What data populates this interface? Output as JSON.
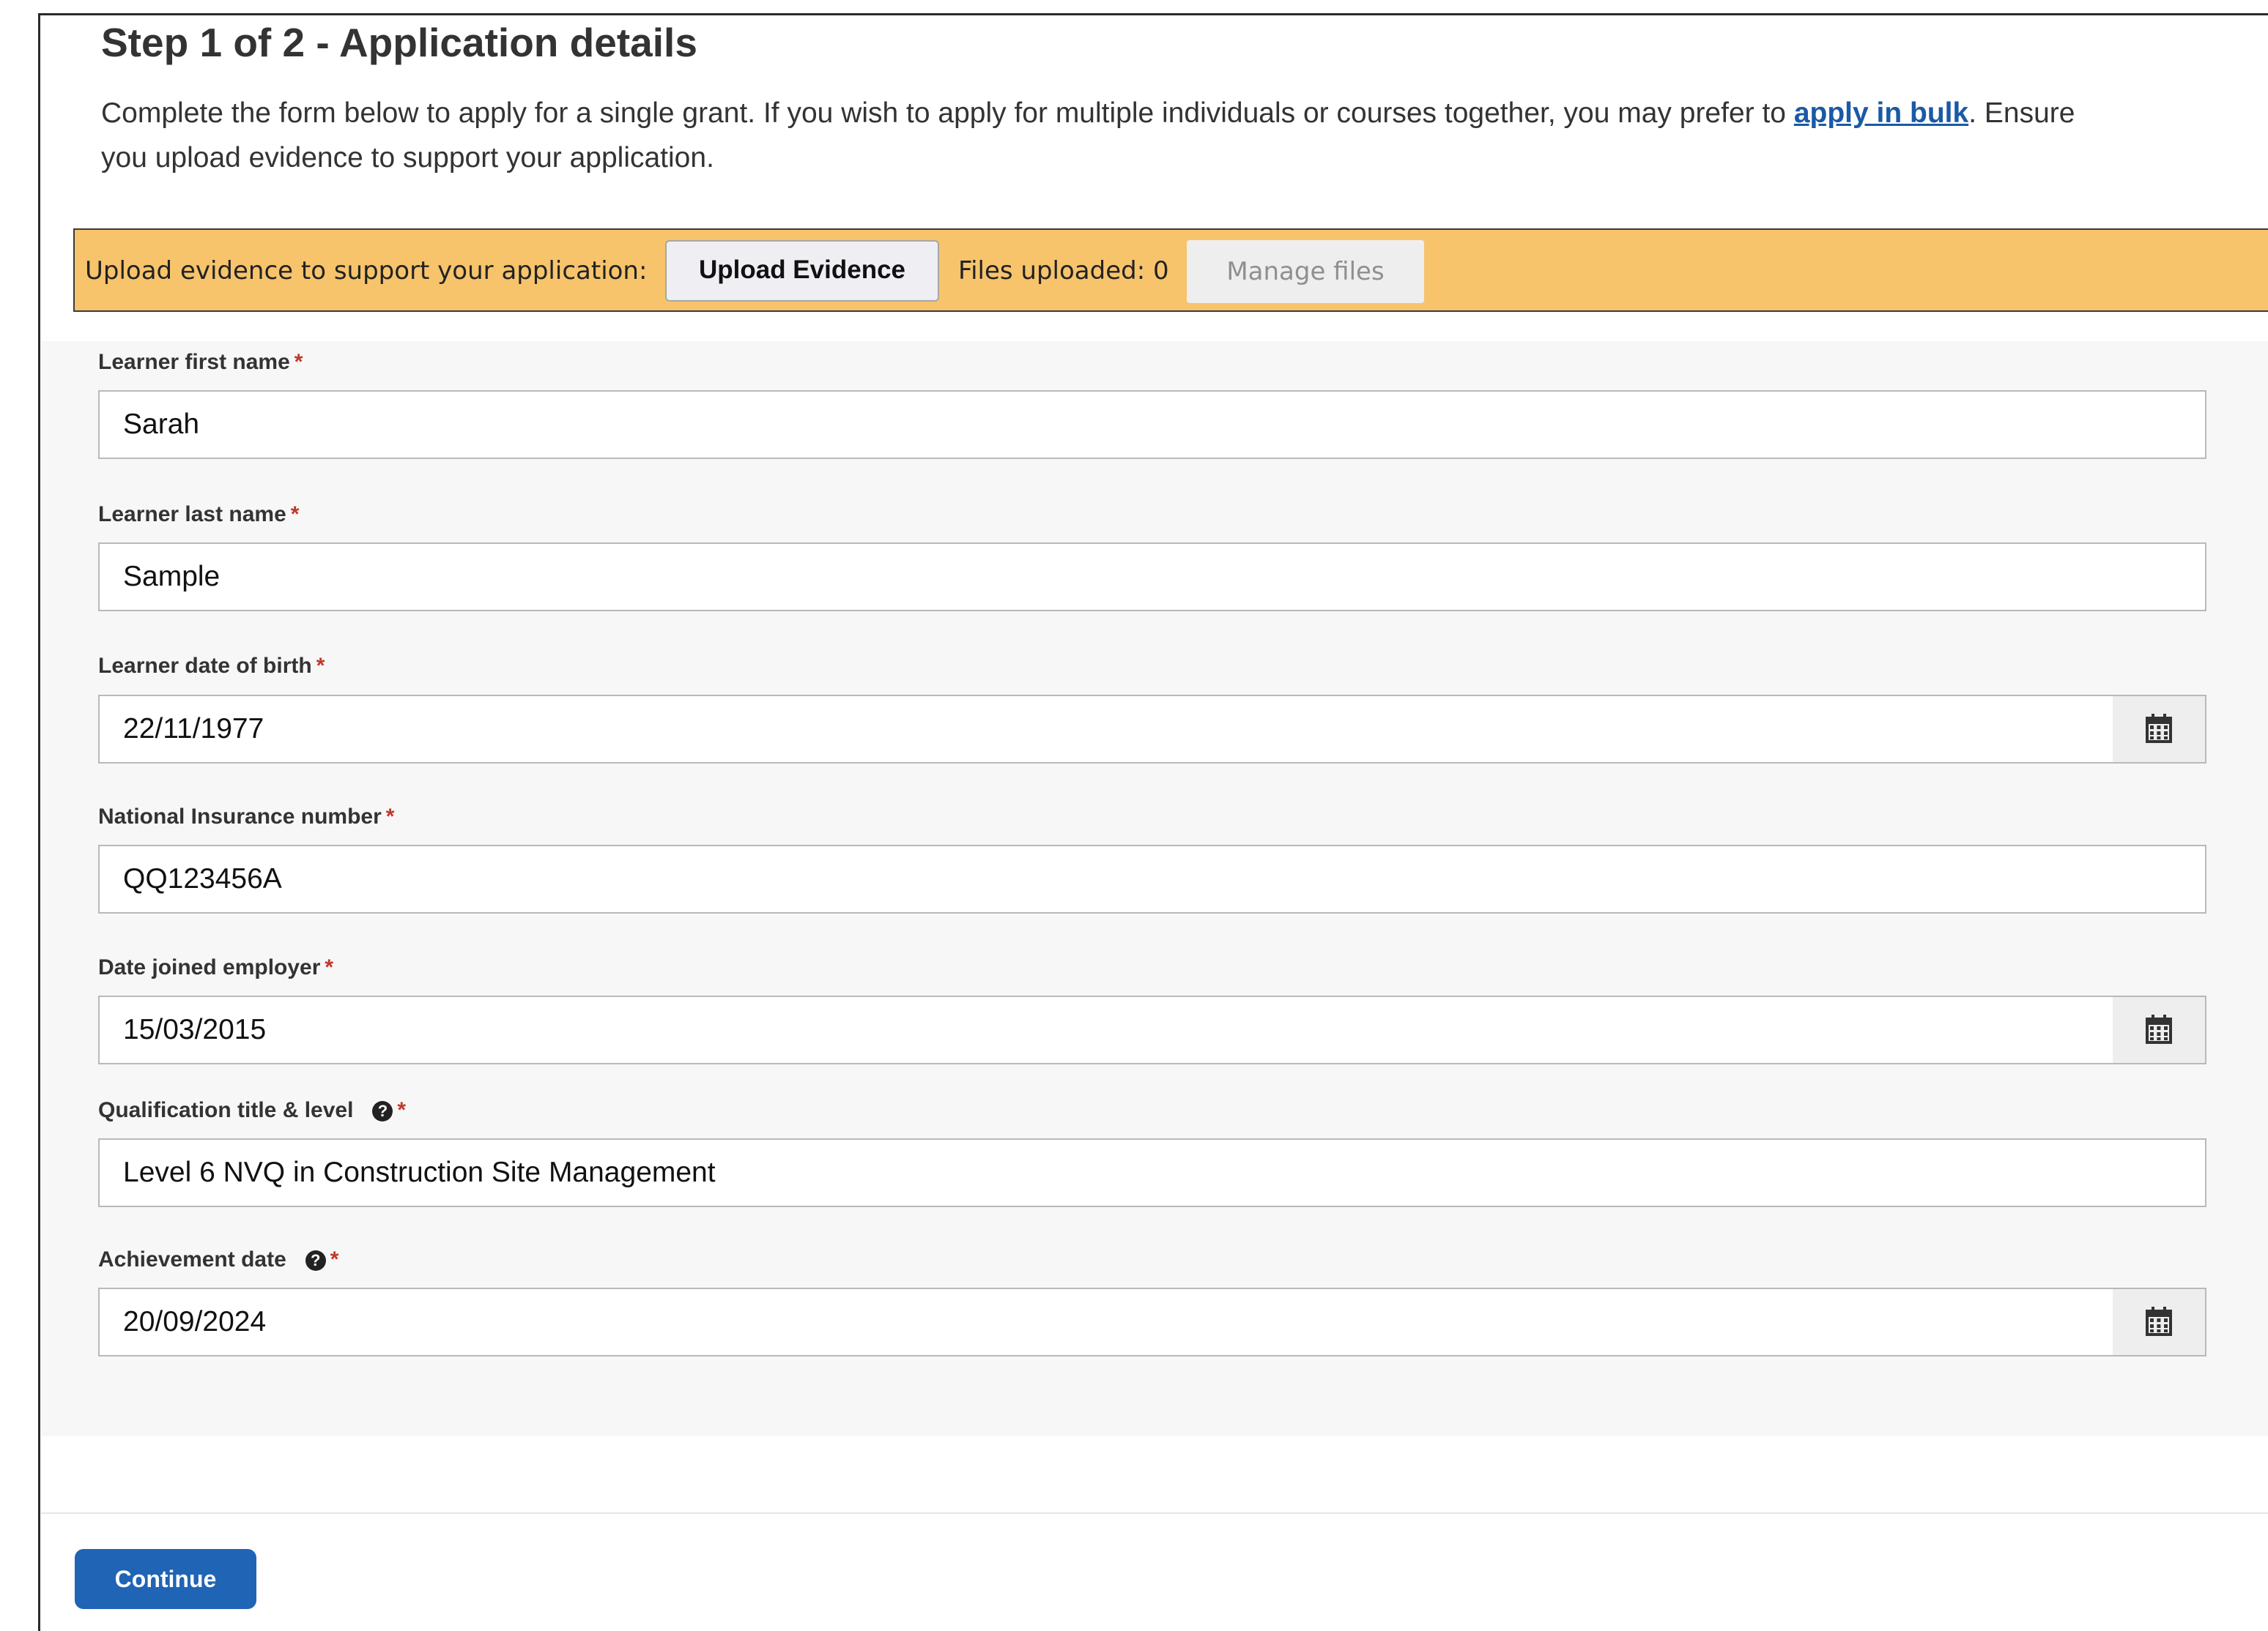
{
  "header": {
    "title": "Step 1 of 2 - Application details",
    "intro_before_link": "Complete the form below to apply for a single grant. If you wish to apply for multiple individuals or courses together, you may prefer to ",
    "intro_link": "apply in bulk",
    "intro_after_link": ". Ensure",
    "intro_line2": "you upload evidence to support your application."
  },
  "evidence_banner": {
    "label": "Upload evidence to support your application:",
    "upload_button": "Upload Evidence",
    "files_uploaded": "Files uploaded: 0",
    "manage_button": "Manage files"
  },
  "form": {
    "first_name": {
      "label": "Learner first name",
      "required": "*",
      "value": "Sarah"
    },
    "last_name": {
      "label": "Learner last name",
      "required": "*",
      "value": "Sample"
    },
    "dob": {
      "label": "Learner date of birth",
      "required": "*",
      "value": "22/11/1977"
    },
    "ni_number": {
      "label": "National Insurance number",
      "required": "*",
      "value": "QQ123456A"
    },
    "date_joined": {
      "label": "Date joined employer",
      "required": "*",
      "value": "15/03/2015"
    },
    "qualification": {
      "label": "Qualification title & level",
      "help_icon": "question-circle-icon",
      "required": "*",
      "value": "Level 6 NVQ in Construction Site Management"
    },
    "achievement_date": {
      "label": "Achievement date",
      "help_icon": "question-circle-icon",
      "required": "*",
      "value": "20/09/2024"
    }
  },
  "footer": {
    "continue_button": "Continue"
  },
  "colors": {
    "banner": "#f7c46c",
    "primary_button": "#1f64b5",
    "link": "#1a5aa5",
    "required": "#c0392b"
  }
}
